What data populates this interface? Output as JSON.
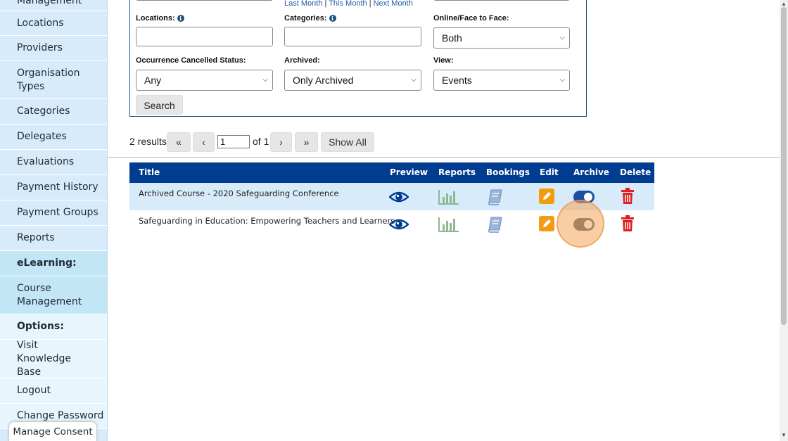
{
  "sidebar": {
    "items": [
      {
        "label": "Management"
      },
      {
        "label": "Locations"
      },
      {
        "label": "Providers"
      },
      {
        "label": "Organisation Types"
      },
      {
        "label": "Categories"
      },
      {
        "label": "Delegates"
      },
      {
        "label": "Evaluations"
      },
      {
        "label": "Payment History"
      },
      {
        "label": "Payment Groups"
      },
      {
        "label": "Reports"
      },
      {
        "label": "eLearning:"
      },
      {
        "label": "Course Management"
      },
      {
        "label": "Options:"
      },
      {
        "label": "Visit Knowledge Base"
      },
      {
        "label": "Logout"
      },
      {
        "label": "Change Password"
      }
    ],
    "manage_consent": "Manage Consent"
  },
  "filters": {
    "month_links": {
      "last": "Last Month",
      "this": "This Month",
      "next": "Next Month",
      "sep": "|"
    },
    "locations_label": "Locations:",
    "categories_label": "Categories:",
    "online_label": "Online/Face to Face:",
    "online_value": "Both",
    "cancelled_label": "Occurrence Cancelled Status:",
    "cancelled_value": "Any",
    "archived_label": "Archived:",
    "archived_value": "Only Archived",
    "view_label": "View:",
    "view_value": "Events",
    "search_button": "Search"
  },
  "pagination": {
    "results": "2 results",
    "first": "«",
    "prev": "‹",
    "page": "1",
    "of": "of 1",
    "next": "›",
    "last": "»",
    "show_all": "Show All"
  },
  "table": {
    "headers": {
      "title": "Title",
      "preview": "Preview",
      "reports": "Reports",
      "bookings": "Bookings",
      "edit": "Edit",
      "archive": "Archive",
      "delete": "Delete"
    },
    "rows": [
      {
        "title": "Archived Course - 2020 Safeguarding Conference",
        "archived": true
      },
      {
        "title": "Safeguarding in Education: Empowering Teachers and Learners",
        "archived": false
      }
    ]
  },
  "colors": {
    "header_bg": "#003c8f",
    "sidebar_bg": "#d8ebfb",
    "edit": "#f39c12",
    "delete": "#e02020",
    "toggle_on": "#1d4ea0",
    "toggle_off": "#4a5a70"
  },
  "icons": [
    "info-icon",
    "eye-icon",
    "bar-chart-icon",
    "book-icon",
    "pencil-icon",
    "toggle-icon",
    "trash-icon",
    "chevron-down-icon"
  ]
}
